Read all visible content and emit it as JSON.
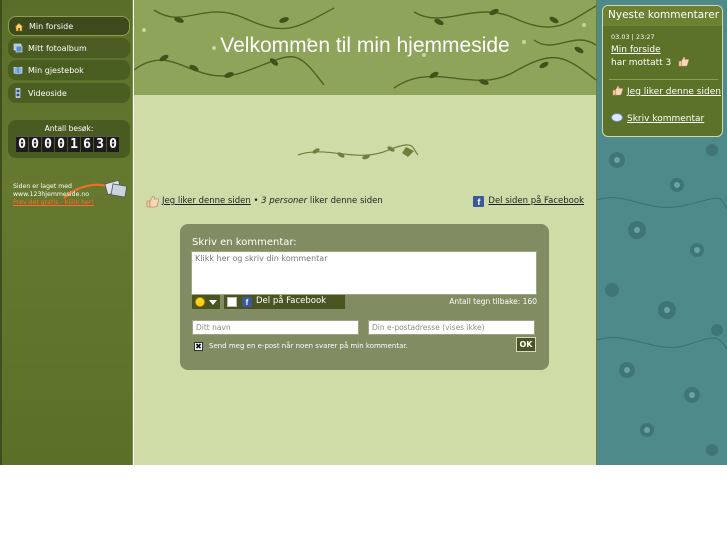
{
  "sidebar": {
    "items": [
      {
        "label": "Min forside",
        "icon": "home-icon"
      },
      {
        "label": "Mitt fotoalbum",
        "icon": "photo-album-icon"
      },
      {
        "label": "Min gjestebok",
        "icon": "guestbook-icon"
      },
      {
        "label": "Videoside",
        "icon": "video-icon"
      }
    ],
    "counter_label": "Antall besøk:",
    "counter_digits": [
      "0",
      "0",
      "0",
      "0",
      "1",
      "6",
      "3",
      "0"
    ],
    "made_with_line1": "Siden er laget med",
    "made_with_line2": "www.123hjemmeside.no",
    "try_free": "Prøv det gratis - Klikk her!"
  },
  "header": {
    "title": "Velkommen til min hjemmeside"
  },
  "likes": {
    "like_link": "Jeg liker denne siden",
    "bullet": " • ",
    "count_text": "3 personer",
    "suffix": " liker denne siden",
    "share_link": "Del siden på Facebook",
    "fb_letter": "f"
  },
  "comment_form": {
    "title": "Skriv en kommentar:",
    "textarea_placeholder": "Klikk her og skriv din kommentar",
    "share_label": "Del på Facebook",
    "chars_left": "Antall tegn tilbake: 160",
    "name_placeholder": "Ditt navn",
    "email_placeholder": "Din e-postadresse (vises ikke)",
    "notify_label": "Send meg en e-post når noen svarer på min kommentar.",
    "notify_checked": "✖",
    "ok_label": "OK"
  },
  "latest_comments": {
    "header": "Nyeste kommentarer",
    "date": "03.03 | 23:27",
    "link": "Min forside",
    "received": "har mottatt 3",
    "like_link": "Jeg liker denne siden",
    "write_link": "Skriv kommentar"
  },
  "colors": {
    "sidebar": "#596e2a",
    "content": "#cfdca8",
    "header": "#8fa45b",
    "right_bg": "#4f8a8a",
    "facebook": "#3b5998"
  }
}
